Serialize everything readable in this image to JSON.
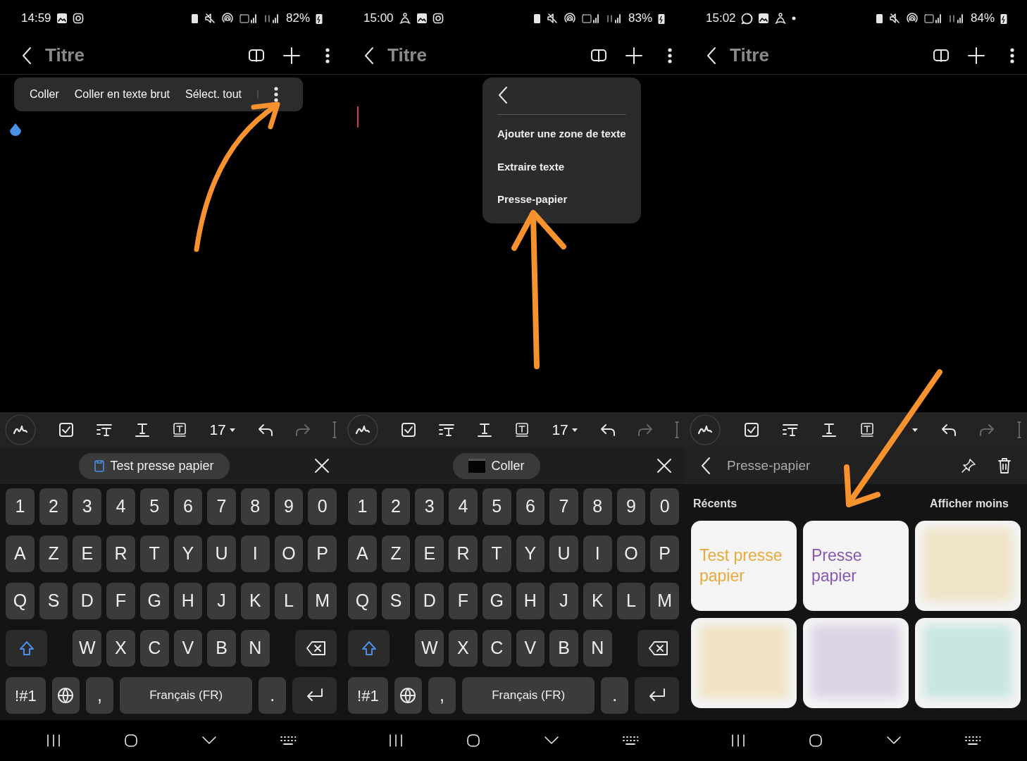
{
  "screens": [
    {
      "status": {
        "time": "14:59",
        "battery": "82%",
        "notifications": [
          {
            "kind": "gallery"
          },
          {
            "kind": "instagram"
          }
        ]
      },
      "app_bar": {
        "title": "Titre"
      },
      "editor": {
        "kind": "selection",
        "toolbar": [
          "Coller",
          "Coller en texte brut",
          "Sélect. tout"
        ]
      },
      "format_toolbar": {
        "font_size": "17"
      },
      "bottom": {
        "kind": "keyboard",
        "suggestion": {
          "kind": "clipboard",
          "label": "Test presse papier"
        },
        "rows": [
          [
            "1",
            "2",
            "3",
            "4",
            "5",
            "6",
            "7",
            "8",
            "9",
            "0"
          ],
          [
            "A",
            "Z",
            "E",
            "R",
            "T",
            "Y",
            "U",
            "I",
            "O",
            "P"
          ],
          [
            "Q",
            "S",
            "D",
            "F",
            "G",
            "H",
            "J",
            "K",
            "L",
            "M"
          ],
          [
            {
              "kind": "shift"
            },
            "",
            "W",
            "X",
            "C",
            "V",
            "B",
            "N",
            "",
            {
              "kind": "backspace"
            }
          ]
        ],
        "function_row": {
          "symbols": "!#1",
          "comma": ",",
          "space": "Français (FR)",
          "period": "."
        }
      }
    },
    {
      "status": {
        "time": "15:00",
        "battery": "83%",
        "notifications": [
          {
            "kind": "meditation"
          },
          {
            "kind": "gallery"
          },
          {
            "kind": "instagram"
          }
        ]
      },
      "app_bar": {
        "title": "Titre"
      },
      "editor": {
        "kind": "menu",
        "menu": [
          "Ajouter une zone de texte",
          "Extraire texte",
          "Presse-papier"
        ]
      },
      "format_toolbar": {
        "font_size": "17"
      },
      "bottom": {
        "kind": "keyboard",
        "suggestion": {
          "kind": "image",
          "label": "Coller"
        },
        "rows": [
          [
            "1",
            "2",
            "3",
            "4",
            "5",
            "6",
            "7",
            "8",
            "9",
            "0"
          ],
          [
            "A",
            "Z",
            "E",
            "R",
            "T",
            "Y",
            "U",
            "I",
            "O",
            "P"
          ],
          [
            "Q",
            "S",
            "D",
            "F",
            "G",
            "H",
            "J",
            "K",
            "L",
            "M"
          ],
          [
            {
              "kind": "shift"
            },
            "",
            "W",
            "X",
            "C",
            "V",
            "B",
            "N",
            "",
            {
              "kind": "backspace"
            }
          ]
        ],
        "function_row": {
          "symbols": "!#1",
          "comma": ",",
          "space": "Français (FR)",
          "period": "."
        }
      }
    },
    {
      "status": {
        "time": "15:02",
        "battery": "84%",
        "notifications": [
          {
            "kind": "whatsapp"
          },
          {
            "kind": "gallery"
          },
          {
            "kind": "meditation"
          },
          {
            "kind": "dot"
          }
        ]
      },
      "app_bar": {
        "title": "Titre"
      },
      "editor": {
        "kind": "empty"
      },
      "bottom": {
        "kind": "clipboard",
        "title": "Presse-papier",
        "section": "Récents",
        "toggle": "Afficher moins",
        "items": [
          {
            "kind": "text",
            "text": "Test presse papier",
            "color": "#e9a93a"
          },
          {
            "kind": "text",
            "text": "Presse papier",
            "color": "#8a55b0"
          },
          {
            "kind": "blurred",
            "color": "#efe3c8"
          },
          {
            "kind": "blurred",
            "color": "#f0e2c4"
          },
          {
            "kind": "blurred",
            "color": "#ddd3e6"
          },
          {
            "kind": "blurred",
            "color": "#c9e6e2"
          }
        ]
      }
    }
  ]
}
